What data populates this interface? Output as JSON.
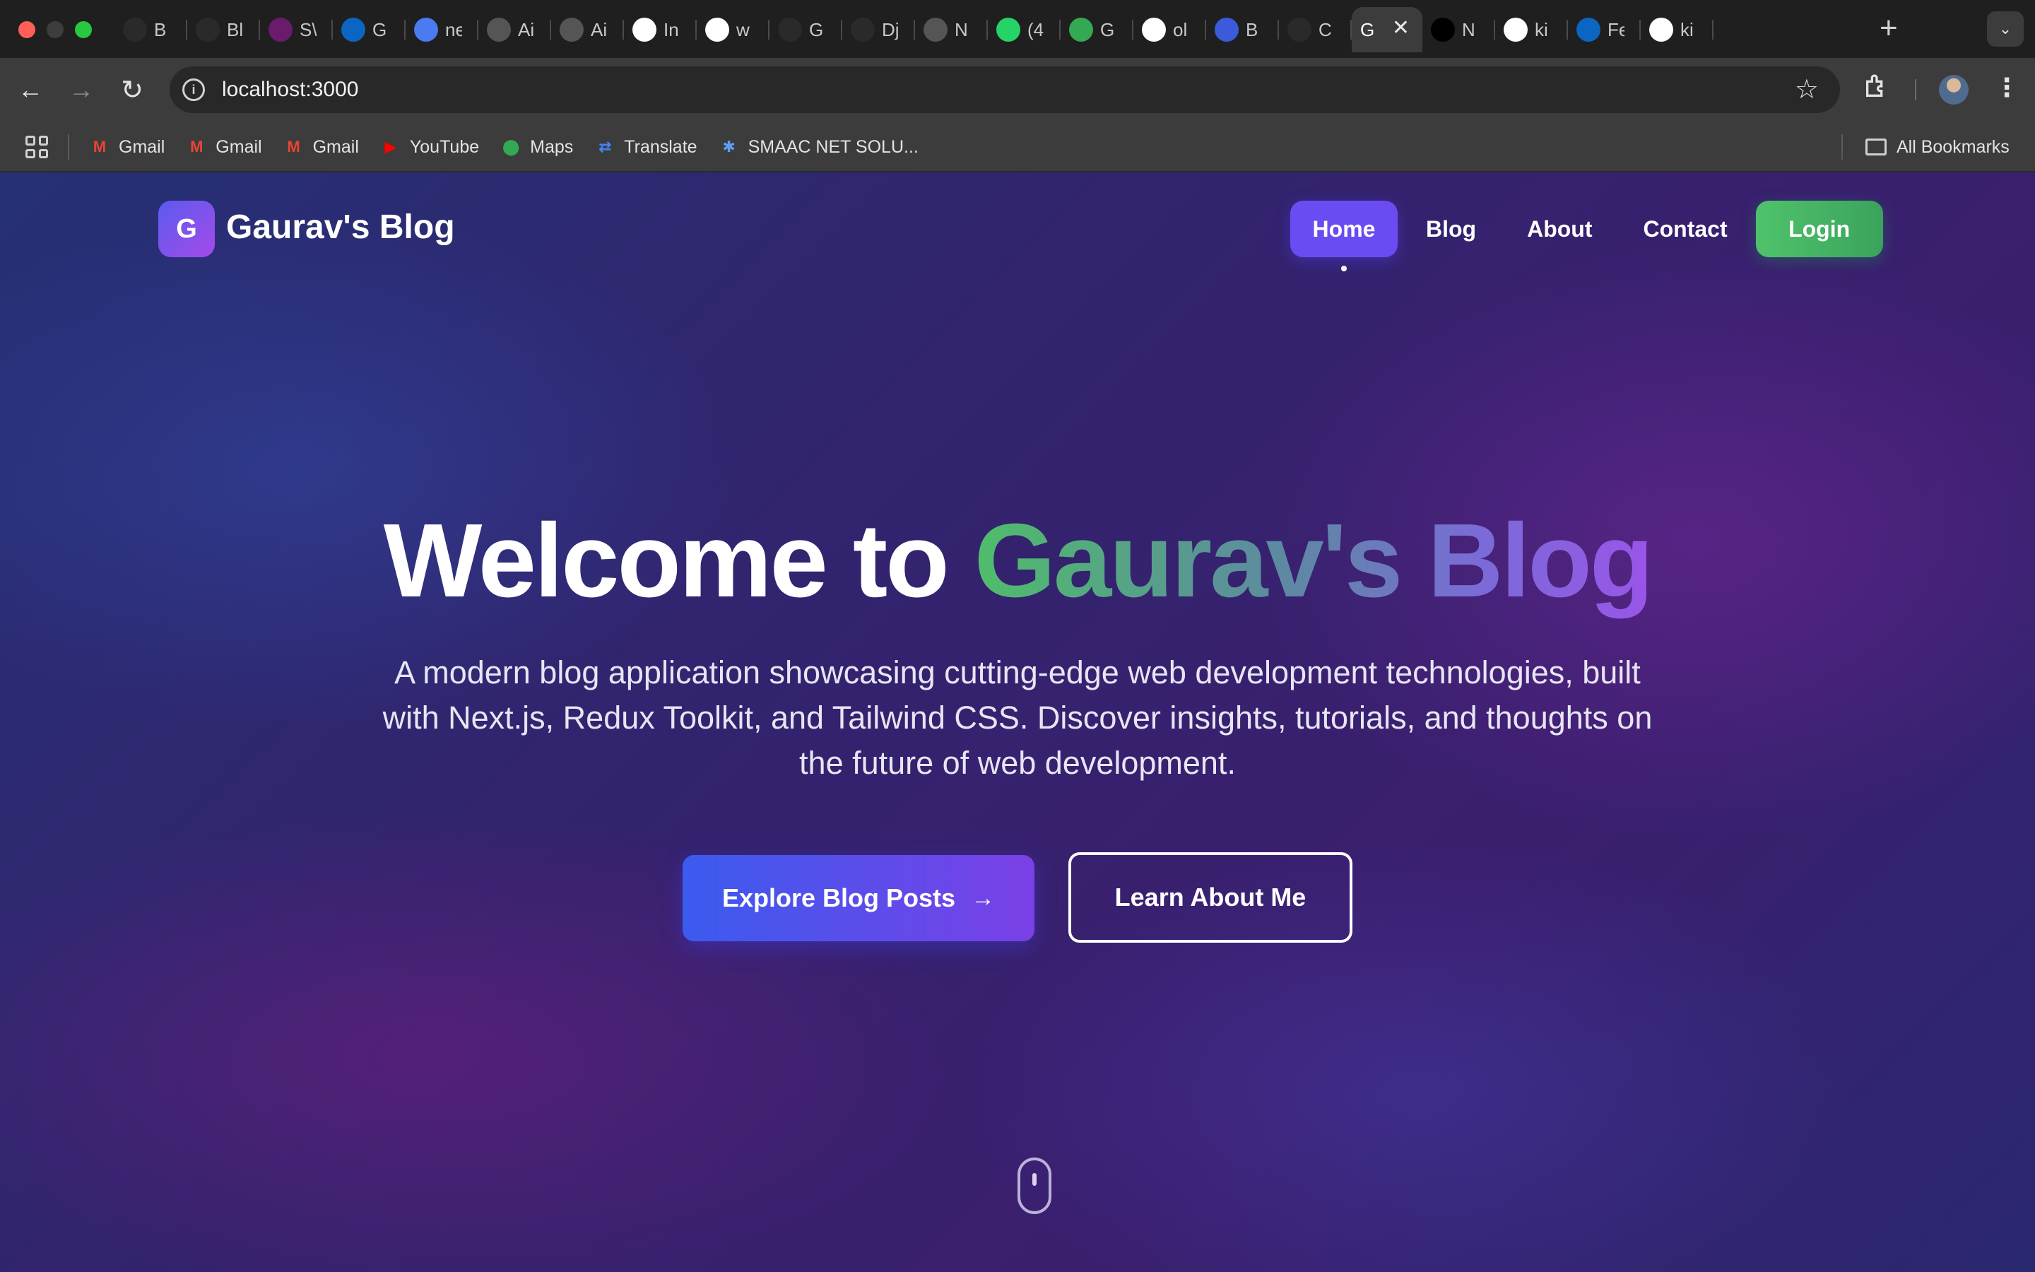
{
  "browser": {
    "tabs": [
      {
        "label": "B",
        "icon": "openai-icon",
        "color": "#2a2a2a"
      },
      {
        "label": "Bl",
        "icon": "openai-icon",
        "color": "#2a2a2a"
      },
      {
        "label": "S\\",
        "icon": "crown-icon",
        "color": "#6b1b6b"
      },
      {
        "label": "G",
        "icon": "linkedin-icon",
        "color": "#0a66c2"
      },
      {
        "label": "ne",
        "icon": "docs-icon",
        "color": "#4a7bf0"
      },
      {
        "label": "Ai",
        "icon": "circle-logo-icon",
        "color": "#555555"
      },
      {
        "label": "Ai",
        "icon": "circle-logo-icon",
        "color": "#555555"
      },
      {
        "label": "In",
        "icon": "info-icon",
        "color": "#ffffff"
      },
      {
        "label": "w",
        "icon": "google-icon",
        "color": "#ffffff"
      },
      {
        "label": "G",
        "icon": "slash-logo-icon",
        "color": "#2a2a2a"
      },
      {
        "label": "Dj",
        "icon": "slash-logo-icon",
        "color": "#2a2a2a"
      },
      {
        "label": "N",
        "icon": "chrome-icon",
        "color": "#555555"
      },
      {
        "label": "(4",
        "icon": "whatsapp-icon",
        "color": "#25d366"
      },
      {
        "label": "G",
        "icon": "meet-icon",
        "color": "#34a853"
      },
      {
        "label": "ol",
        "icon": "google-icon",
        "color": "#ffffff"
      },
      {
        "label": "B",
        "icon": "s-logo-icon",
        "color": "#3b5bdb"
      },
      {
        "label": "C",
        "icon": "stack-logo-icon",
        "color": "#2a2a2a"
      },
      {
        "label": "G",
        "icon": "g-letter-icon",
        "color": "#3c3c3c",
        "active": true
      },
      {
        "label": "N",
        "icon": "notion-icon",
        "color": "#000000"
      },
      {
        "label": "ki",
        "icon": "github-icon",
        "color": "#ffffff"
      },
      {
        "label": "Fe",
        "icon": "linkedin-icon",
        "color": "#0a66c2"
      },
      {
        "label": "ki",
        "icon": "github-icon",
        "color": "#ffffff"
      }
    ],
    "url": "localhost:3000",
    "bookmarks": [
      {
        "label": "Gmail",
        "icon": "gmail-icon",
        "color": "#ea4335"
      },
      {
        "label": "Gmail",
        "icon": "gmail-icon",
        "color": "#ea4335"
      },
      {
        "label": "Gmail",
        "icon": "gmail-icon",
        "color": "#ea4335"
      },
      {
        "label": "YouTube",
        "icon": "youtube-icon",
        "color": "#ff0000"
      },
      {
        "label": "Maps",
        "icon": "maps-icon",
        "color": "#34a853"
      },
      {
        "label": "Translate",
        "icon": "translate-icon",
        "color": "#4285f4"
      },
      {
        "label": "SMAAC NET SOLU...",
        "icon": "gear-icon",
        "color": "#5aa0f0"
      }
    ],
    "all_bookmarks": "All Bookmarks"
  },
  "site": {
    "logo_letter": "G",
    "logo_text": "Gaurav's Blog",
    "nav": {
      "home": "Home",
      "blog": "Blog",
      "about": "About",
      "contact": "Contact",
      "login": "Login"
    },
    "hero": {
      "title_plain": "Welcome to ",
      "title_accent": "Gaurav's Blog",
      "description": "A modern blog application showcasing cutting-edge web development technologies, built with Next.js, Redux Toolkit, and Tailwind CSS. Discover insights, tutorials, and thoughts on the future of web development.",
      "primary_button": "Explore Blog Posts",
      "primary_arrow": "→",
      "secondary_button": "Learn About Me"
    }
  },
  "colors": {
    "accent_green": "#4fbd6b",
    "accent_purple": "#9a55e8",
    "nav_active": "#6a4cf2",
    "login_green": "#4fc36b"
  }
}
